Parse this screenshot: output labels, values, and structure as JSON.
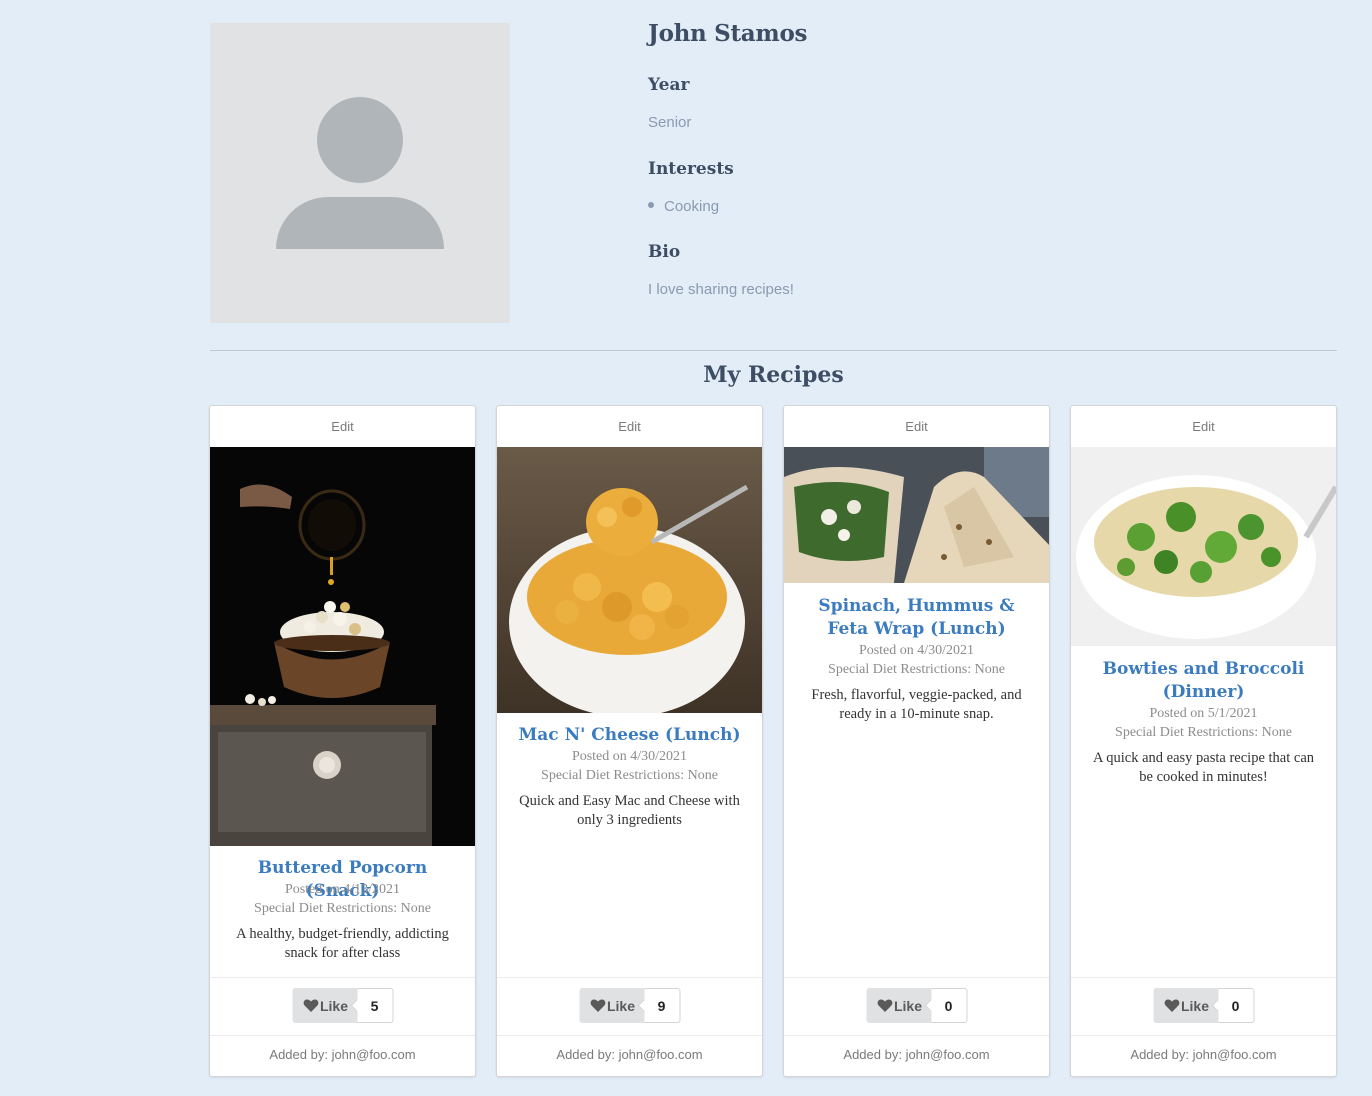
{
  "profile": {
    "name": "John Stamos",
    "year_label": "Year",
    "year": "Senior",
    "interests_label": "Interests",
    "interests": [
      "Cooking"
    ],
    "bio_label": "Bio",
    "bio": "I love sharing recipes!"
  },
  "section_title": "My Recipes",
  "recipes": [
    {
      "edit_label": "Edit",
      "image": "popcorn-photo",
      "title": "Buttered Popcorn (Snack)",
      "posted": "Posted on 4/13/2021",
      "diet": "Special Diet Restrictions: None",
      "description": "A healthy, budget-friendly, addicting snack for after class",
      "like_label": "Like",
      "likes": "5",
      "added_by": "Added by: john@foo.com"
    },
    {
      "edit_label": "Edit",
      "image": "mac-and-cheese-photo",
      "title": "Mac N' Cheese (Lunch)",
      "posted": "Posted on 4/30/2021",
      "diet": "Special Diet Restrictions: None",
      "description": "Quick and Easy Mac and Cheese with only 3 ingredients",
      "like_label": "Like",
      "likes": "9",
      "added_by": "Added by: john@foo.com"
    },
    {
      "edit_label": "Edit",
      "image": "wrap-photo",
      "title": "Spinach, Hummus & Feta Wrap (Lunch)",
      "posted": "Posted on 4/30/2021",
      "diet": "Special Diet Restrictions: None",
      "description": "Fresh, flavorful, veggie-packed, and ready in a 10-minute snap.",
      "like_label": "Like",
      "likes": "0",
      "added_by": "Added by: john@foo.com"
    },
    {
      "edit_label": "Edit",
      "image": "bowtie-pasta-photo",
      "title": "Bowties and Broccoli (Dinner)",
      "posted": "Posted on 5/1/2021",
      "diet": "Special Diet Restrictions: None",
      "description": "A quick and easy pasta recipe that can be cooked in minutes!",
      "like_label": "Like",
      "likes": "0",
      "added_by": "Added by: john@foo.com"
    }
  ],
  "colors": {
    "background": "#e3edf8",
    "heading": "#3d4d63",
    "muted": "#8a9ab0",
    "link": "#3b7bbf"
  }
}
